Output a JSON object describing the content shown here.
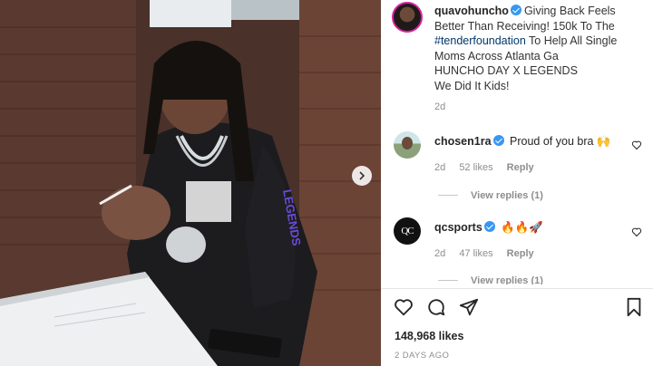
{
  "post": {
    "username": "quavohuncho",
    "caption_lines": [
      "Giving Back Feels",
      "Better Than Receiving! 150k To The",
      "To Help All Single",
      "Moms Across Atlanta Ga",
      "HUNCHO DAY X LEGENDS",
      "We Did It Kids!"
    ],
    "hashtag": "#tenderfoundation",
    "age": "2d",
    "likes": "148,968 likes",
    "timestamp": "2 DAYS AGO"
  },
  "comments": [
    {
      "username": "chosen1ra",
      "text": "Proud of you bra",
      "emoji": "🙌",
      "age": "2d",
      "likes": "52 likes",
      "reply_label": "Reply",
      "view_replies": "View replies (1)"
    },
    {
      "username": "qcsports",
      "text": "",
      "emoji": "🔥🔥🚀",
      "age": "2d",
      "likes": "47 likes",
      "reply_label": "Reply",
      "view_replies": "View replies (1)"
    }
  ],
  "avatars": {
    "qc_monogram": "QC"
  },
  "photo": {
    "shirt_text": "LEGENDS"
  },
  "icons": [
    "verified-badge-icon",
    "heart-icon",
    "comment-icon",
    "share-icon",
    "bookmark-icon",
    "chevron-right-icon"
  ],
  "colors": {
    "verified": "#3897f0",
    "hashtag": "#00376b",
    "meta": "#8e8e8e",
    "story_ring": "#d6249f"
  }
}
